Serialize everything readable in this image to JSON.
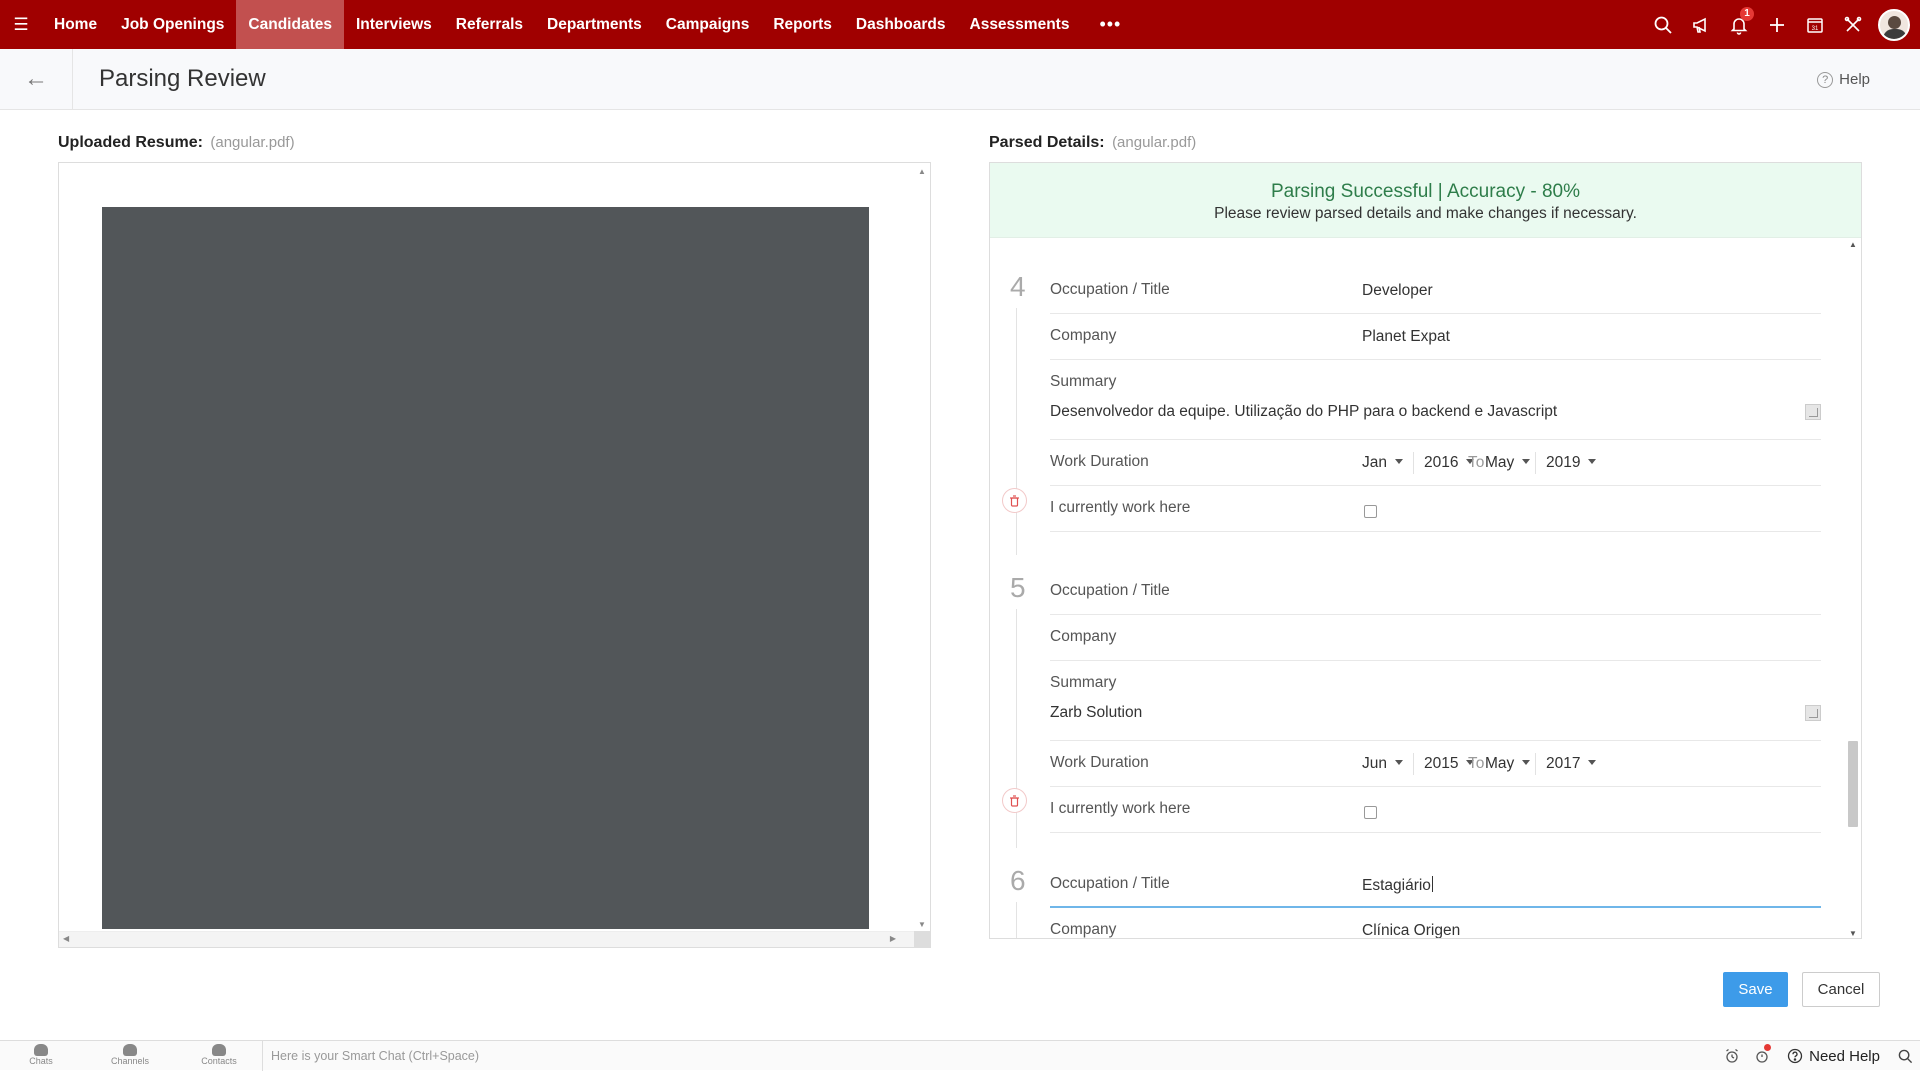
{
  "nav": {
    "items": [
      "Home",
      "Job Openings",
      "Candidates",
      "Interviews",
      "Referrals",
      "Departments",
      "Campaigns",
      "Reports",
      "Dashboards",
      "Assessments"
    ],
    "active": "Candidates",
    "more": "•••",
    "notification_count": "1",
    "calendar_day": "31"
  },
  "header": {
    "title": "Parsing Review",
    "help": "Help",
    "help_icon": "?"
  },
  "left": {
    "label": "Uploaded Resume:",
    "file": "(angular.pdf)"
  },
  "right": {
    "label": "Parsed Details:",
    "file": "(angular.pdf)",
    "banner_title": "Parsing Successful | Accuracy - 80%",
    "banner_sub": "Please review parsed details and make changes if necessary."
  },
  "labels": {
    "occupation": "Occupation / Title",
    "company": "Company",
    "summary": "Summary",
    "work_duration": "Work Duration",
    "current": "I currently work here",
    "to": "To"
  },
  "experiences": [
    {
      "num": "4",
      "title": "Developer",
      "company": "Planet Expat",
      "summary": "Desenvolvedor da equipe. Utilização do PHP para o backend e Javascript",
      "from_month": "Jan",
      "from_year": "2016",
      "to_month": "May",
      "to_year": "2019",
      "current": false
    },
    {
      "num": "5",
      "title": "",
      "company": "",
      "summary": "Zarb Solution",
      "from_month": "Jun",
      "from_year": "2015",
      "to_month": "May",
      "to_year": "2017",
      "current": false
    },
    {
      "num": "6",
      "title": "Estagiário",
      "company": "Clínica Origen"
    }
  ],
  "actions": {
    "save": "Save",
    "cancel": "Cancel"
  },
  "bottom": {
    "chats": "Chats",
    "channels": "Channels",
    "contacts": "Contacts",
    "smart_chat": "Here is your Smart Chat (Ctrl+Space)",
    "need_help": "Need Help"
  },
  "colors": {
    "nav_bg": "#a00000",
    "nav_active": "#c2504f",
    "success": "#2e7d4a",
    "primary": "#3d9be9"
  }
}
